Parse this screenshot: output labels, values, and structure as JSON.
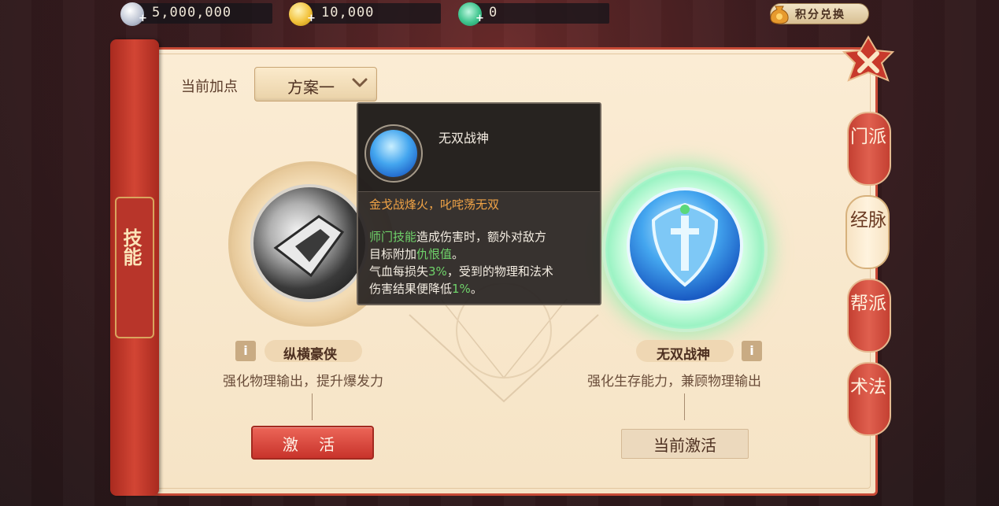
{
  "currency": [
    {
      "icon": "silver-coin-icon",
      "value": "5,000,000"
    },
    {
      "icon": "gold-coin-icon",
      "value": "10,000"
    },
    {
      "icon": "jade-icon",
      "value": "0"
    }
  ],
  "points_exchange": {
    "label": "积分兑换"
  },
  "left_banner": {
    "label": "技能"
  },
  "plan": {
    "label": "当前加点",
    "selected": "方案一"
  },
  "skills": [
    {
      "name": "纵横豪侠",
      "desc": "强化物理输出，提升爆发力",
      "button": "激 活"
    },
    {
      "name": "无双战神",
      "desc": "强化生存能力，兼顾物理输出",
      "button": "当前激活"
    }
  ],
  "tabs": [
    "门派",
    "经脉",
    "帮派",
    "术法"
  ],
  "tooltip": {
    "title": "无双战神",
    "flavor": "金戈战烽火，叱咤荡无双",
    "line1_highlight": "师门技能",
    "line1_rest": "造成伤害时，额外对敌方",
    "line2_start": "目标附加",
    "line2_highlight": "仇恨值",
    "line2_end": "。",
    "line3_start": "气血每损失",
    "line3_highlight": "3%",
    "line3_end": "，受到的物理和法术",
    "line4_start": "伤害结果便降低",
    "line4_highlight": "1%",
    "line4_end": "。"
  },
  "colors": {
    "accent_red": "#c84a36",
    "panel_bg": "#fbecd4",
    "highlight_green": "#6fd36a",
    "flavor_orange": "#f0a346"
  }
}
